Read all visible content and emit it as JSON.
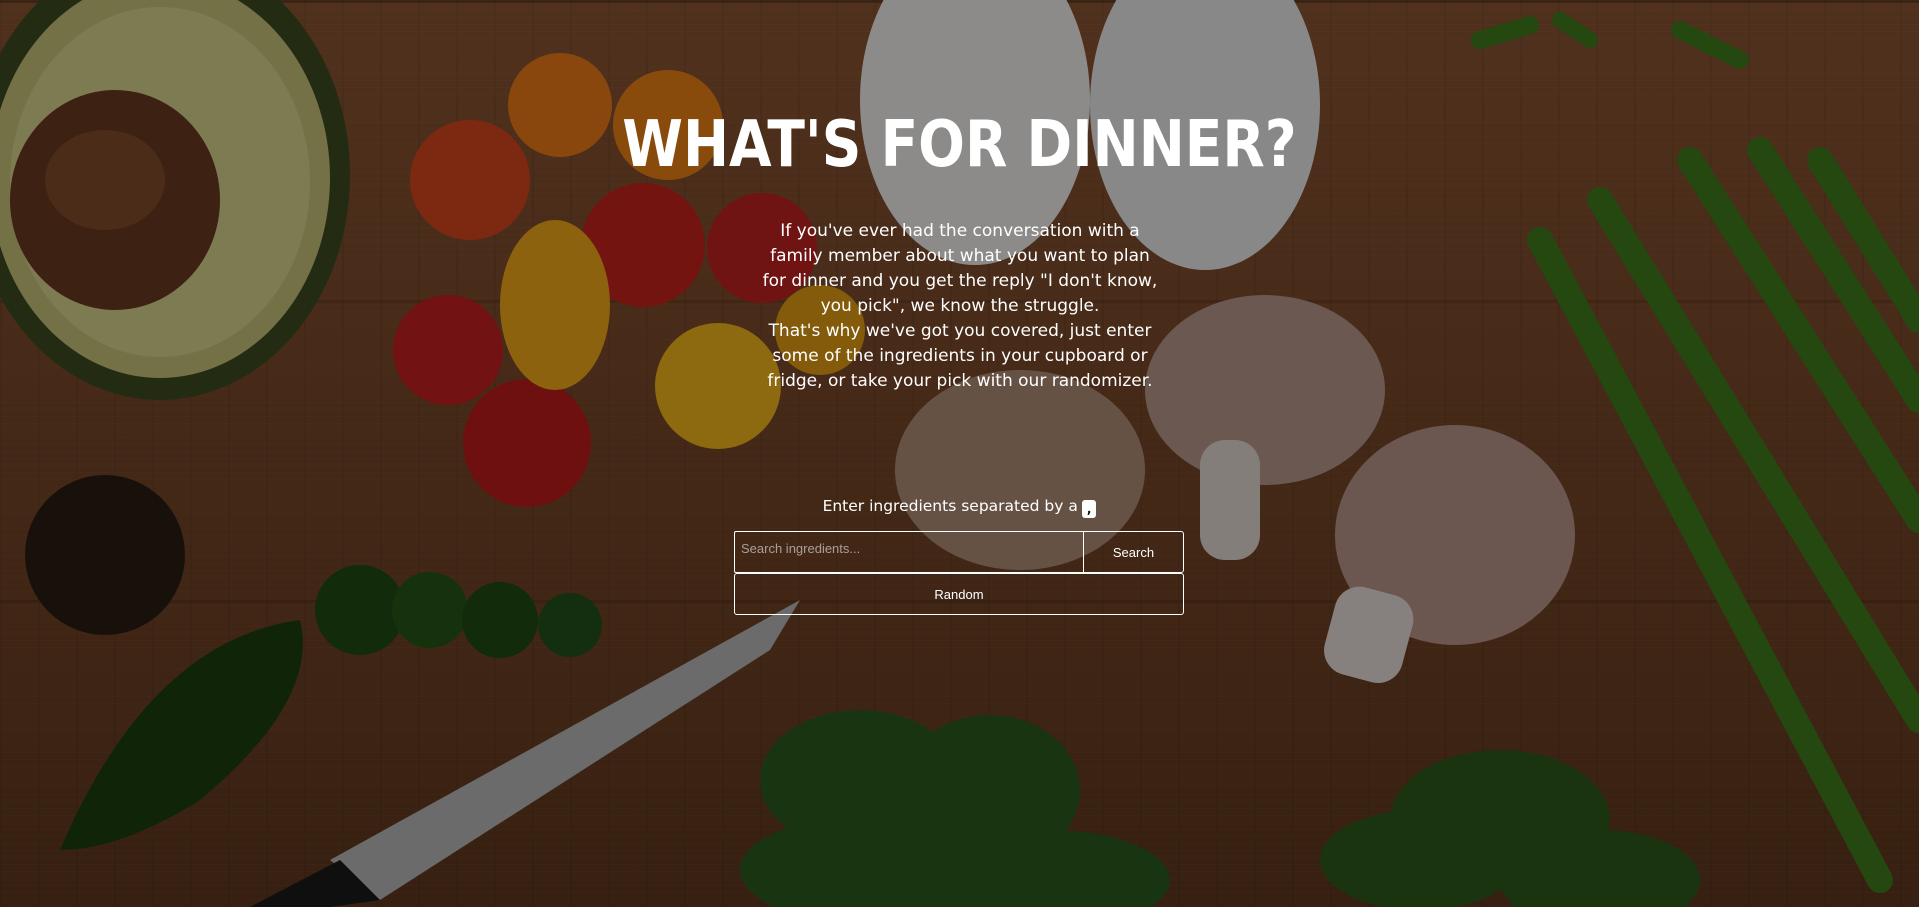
{
  "hero": {
    "title": "WHAT'S FOR DINNER?",
    "intro_line1": "If you've ever had the conversation with a family member about what you want to plan for dinner and you get the reply \"I don't know, you pick\", we know the struggle.",
    "intro_line2": "That's why we've got you covered, just enter some of the ingredients in your cupboard or fridge, or take your pick with our randomizer."
  },
  "search": {
    "hint": "Enter ingredients separated by a",
    "separator_key": ",",
    "placeholder": "Search ingredients...",
    "value": "",
    "search_label": "Search",
    "random_label": "Random"
  },
  "background": {
    "description_icon": "cutting-board-vegetables-photo"
  }
}
